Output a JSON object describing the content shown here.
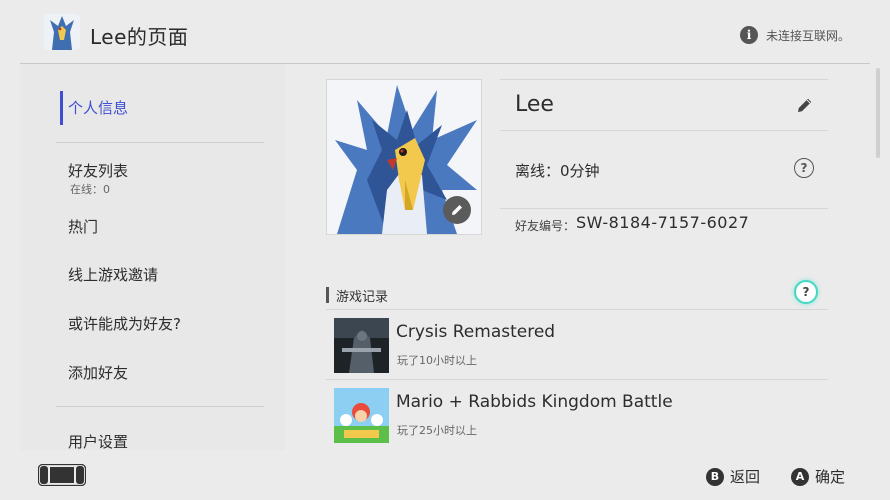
{
  "header": {
    "title": "Lee的页面",
    "status_text": "未连接互联网。",
    "info_icon": "info-icon"
  },
  "sidebar": {
    "items": [
      {
        "label": "个人信息",
        "active": true
      },
      {
        "label": "好友列表",
        "sub": "在线：0"
      },
      {
        "label": "热门"
      },
      {
        "label": "线上游戏邀请"
      },
      {
        "label": "或许能成为好友?"
      },
      {
        "label": "添加好友"
      },
      {
        "label": "用户设置"
      }
    ],
    "accent_color": "#3e4fd1"
  },
  "profile": {
    "name": "Lee",
    "status": "离线：0分钟",
    "friend_code_label": "好友编号：",
    "friend_code": "SW-8184-7157-6027"
  },
  "play_history": {
    "title": "游戏记录",
    "help_highlight_color": "#43d8c3",
    "games": [
      {
        "title": "Crysis Remastered",
        "playtime": "玩了10小时以上"
      },
      {
        "title": "Mario + Rabbids Kingdom Battle",
        "playtime": "玩了25小时以上"
      }
    ]
  },
  "footer": {
    "back_button": "B",
    "back_label": "返回",
    "confirm_button": "A",
    "confirm_label": "确定"
  }
}
